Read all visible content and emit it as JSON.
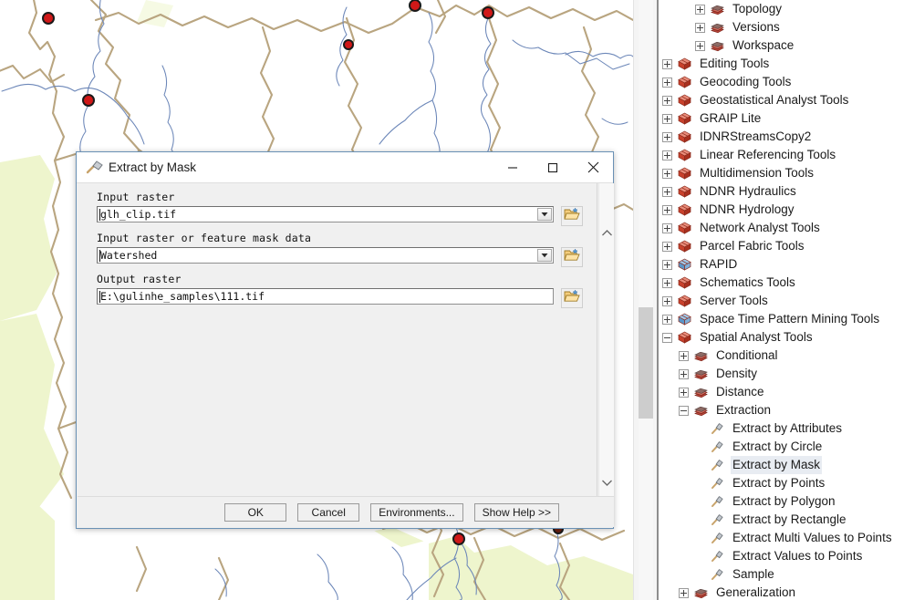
{
  "dialog": {
    "title": "Extract by Mask",
    "title_icon": "hammer-icon",
    "window_buttons": {
      "minimize": "minimize-icon",
      "maximize": "maximize-icon",
      "close": "close-icon"
    },
    "fields": [
      {
        "label": "Input raster",
        "value": "glh_clip.tif",
        "type": "combo",
        "browse_icon": "open-folder-icon"
      },
      {
        "label": "Input raster or feature mask data",
        "value": "Watershed",
        "type": "combo",
        "browse_icon": "open-folder-icon"
      },
      {
        "label": "Output raster",
        "value": "E:\\gulinhe_samples\\111.tif",
        "type": "text",
        "browse_icon": "open-folder-icon"
      }
    ],
    "buttons": [
      {
        "label": "OK"
      },
      {
        "label": "Cancel"
      },
      {
        "label": "Environments..."
      },
      {
        "label": "Show Help >>"
      }
    ],
    "scrollbar": {
      "up_icon": "chevron-up-icon",
      "down_icon": "chevron-down-icon"
    }
  },
  "toolbox": {
    "items": [
      {
        "label": "Topology",
        "level": 2,
        "icon": "toolset-icon",
        "expander": "plus",
        "selected": false
      },
      {
        "label": "Versions",
        "level": 2,
        "icon": "toolset-icon",
        "expander": "plus",
        "selected": false
      },
      {
        "label": "Workspace",
        "level": 2,
        "icon": "toolset-icon",
        "expander": "plus",
        "selected": false
      },
      {
        "label": "Editing Tools",
        "level": 0,
        "icon": "toolbox-icon",
        "expander": "plus",
        "selected": false
      },
      {
        "label": "Geocoding Tools",
        "level": 0,
        "icon": "toolbox-icon",
        "expander": "plus",
        "selected": false
      },
      {
        "label": "Geostatistical Analyst Tools",
        "level": 0,
        "icon": "toolbox-icon",
        "expander": "plus",
        "selected": false
      },
      {
        "label": "GRAIP Lite",
        "level": 0,
        "icon": "toolbox-icon",
        "expander": "plus",
        "selected": false
      },
      {
        "label": "IDNRStreamsCopy2",
        "level": 0,
        "icon": "toolbox-icon",
        "expander": "plus",
        "selected": false
      },
      {
        "label": "Linear Referencing Tools",
        "level": 0,
        "icon": "toolbox-icon",
        "expander": "plus",
        "selected": false
      },
      {
        "label": "Multidimension Tools",
        "level": 0,
        "icon": "toolbox-icon",
        "expander": "plus",
        "selected": false
      },
      {
        "label": "NDNR Hydraulics",
        "level": 0,
        "icon": "toolbox-icon",
        "expander": "plus",
        "selected": false
      },
      {
        "label": "NDNR Hydrology",
        "level": 0,
        "icon": "toolbox-icon",
        "expander": "plus",
        "selected": false
      },
      {
        "label": "Network Analyst Tools",
        "level": 0,
        "icon": "toolbox-icon",
        "expander": "plus",
        "selected": false
      },
      {
        "label": "Parcel Fabric Tools",
        "level": 0,
        "icon": "toolbox-icon",
        "expander": "plus",
        "selected": false
      },
      {
        "label": "RAPID",
        "level": 0,
        "icon": "toolbox-blue-icon",
        "expander": "plus",
        "selected": false
      },
      {
        "label": "Schematics Tools",
        "level": 0,
        "icon": "toolbox-icon",
        "expander": "plus",
        "selected": false
      },
      {
        "label": "Server Tools",
        "level": 0,
        "icon": "toolbox-icon",
        "expander": "plus",
        "selected": false
      },
      {
        "label": "Space Time Pattern Mining Tools",
        "level": 0,
        "icon": "toolbox-blue-icon",
        "expander": "plus",
        "selected": false
      },
      {
        "label": "Spatial Analyst Tools",
        "level": 0,
        "icon": "toolbox-icon",
        "expander": "minus",
        "selected": false
      },
      {
        "label": "Conditional",
        "level": 1,
        "icon": "toolset-icon",
        "expander": "plus",
        "selected": false
      },
      {
        "label": "Density",
        "level": 1,
        "icon": "toolset-icon",
        "expander": "plus",
        "selected": false
      },
      {
        "label": "Distance",
        "level": 1,
        "icon": "toolset-icon",
        "expander": "plus",
        "selected": false
      },
      {
        "label": "Extraction",
        "level": 1,
        "icon": "toolset-icon",
        "expander": "minus",
        "selected": false
      },
      {
        "label": "Extract by Attributes",
        "level": 2,
        "icon": "tool-icon",
        "expander": "none",
        "selected": false
      },
      {
        "label": "Extract by Circle",
        "level": 2,
        "icon": "tool-icon",
        "expander": "none",
        "selected": false
      },
      {
        "label": "Extract by Mask",
        "level": 2,
        "icon": "tool-icon",
        "expander": "none",
        "selected": true
      },
      {
        "label": "Extract by Points",
        "level": 2,
        "icon": "tool-icon",
        "expander": "none",
        "selected": false
      },
      {
        "label": "Extract by Polygon",
        "level": 2,
        "icon": "tool-icon",
        "expander": "none",
        "selected": false
      },
      {
        "label": "Extract by Rectangle",
        "level": 2,
        "icon": "tool-icon",
        "expander": "none",
        "selected": false
      },
      {
        "label": "Extract Multi Values to Points",
        "level": 2,
        "icon": "tool-icon",
        "expander": "none",
        "selected": false
      },
      {
        "label": "Extract Values to Points",
        "level": 2,
        "icon": "tool-icon",
        "expander": "none",
        "selected": false
      },
      {
        "label": "Sample",
        "level": 2,
        "icon": "tool-icon",
        "expander": "none",
        "selected": false
      },
      {
        "label": "Generalization",
        "level": 1,
        "icon": "toolset-icon",
        "expander": "plus",
        "selected": false
      }
    ]
  },
  "map": {
    "background_color": "#ffffff",
    "land_fill_color": "#eef5cd",
    "boundary_color": "#b9a580",
    "stream_color": "#6b86b8",
    "marker_fill_color": "#d01818",
    "marker_outline_color": "#1a1a1a"
  },
  "colors": {
    "dialog_border": "#6a91b5",
    "dialog_bg": "#f0f0f0",
    "selection_bg": "#e8ecf2",
    "scrollbar_thumb": "#cdcdcd"
  }
}
